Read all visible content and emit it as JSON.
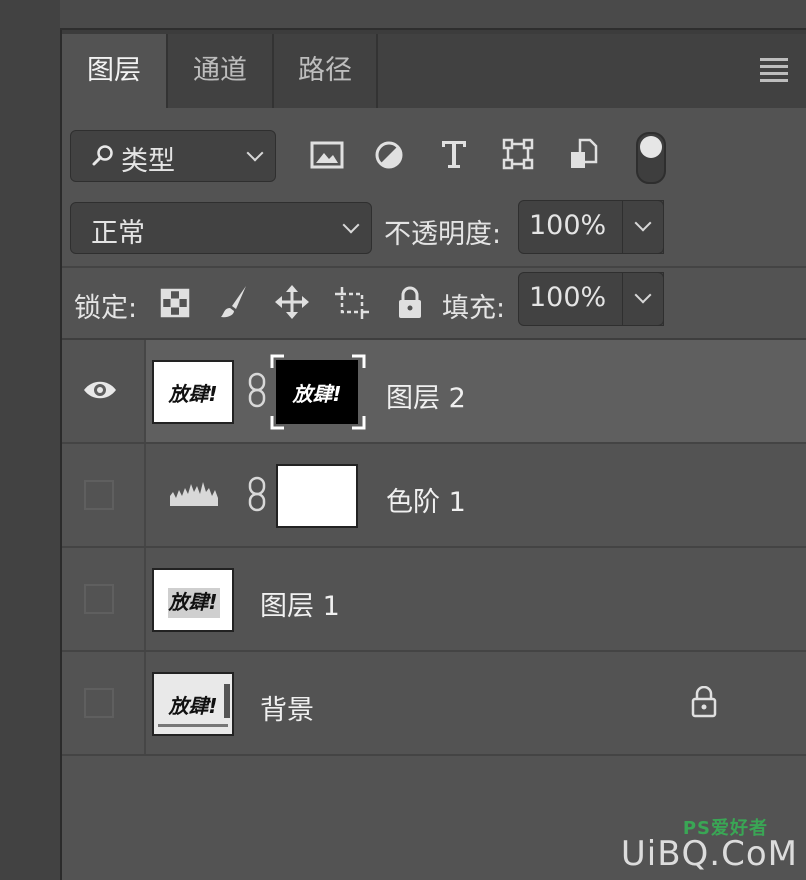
{
  "tabs": [
    {
      "label": "图层",
      "active": true
    },
    {
      "label": "通道",
      "active": false
    },
    {
      "label": "路径",
      "active": false
    }
  ],
  "filter": {
    "search_icon": "search-icon",
    "kind_label": "类型"
  },
  "filter_icons": [
    "image-filter-icon",
    "adjustment-filter-icon",
    "type-filter-icon",
    "shape-filter-icon",
    "smart-object-filter-icon",
    "filter-toggle-icon"
  ],
  "blend": {
    "mode": "正常",
    "opacity_label": "不透明度:",
    "opacity_value": "100%"
  },
  "lock": {
    "label": "锁定:",
    "fill_label": "填充:",
    "fill_value": "100%",
    "icons": [
      "lock-transparent-pixels-icon",
      "lock-image-pixels-icon",
      "lock-position-icon",
      "lock-artboard-icon",
      "lock-all-icon"
    ]
  },
  "layers": [
    {
      "name": "图层 2",
      "visible": true,
      "selected": true,
      "thumb_text": "放肆!",
      "mask_text": "放肆!"
    },
    {
      "name": "色阶 1",
      "visible": false,
      "selected": false,
      "type": "levels-adjustment"
    },
    {
      "name": "图层 1",
      "visible": false,
      "selected": false,
      "thumb_text": "放肆!"
    },
    {
      "name": "背景",
      "visible": false,
      "selected": false,
      "thumb_text": "放肆!",
      "locked": true
    }
  ],
  "watermark": {
    "brand_small": "PS爱好者",
    "site": "UiBQ.CoM"
  },
  "colors": {
    "panel_bg": "#535353",
    "selected_row": "#5f5f5f",
    "tab_bar": "#414141"
  }
}
